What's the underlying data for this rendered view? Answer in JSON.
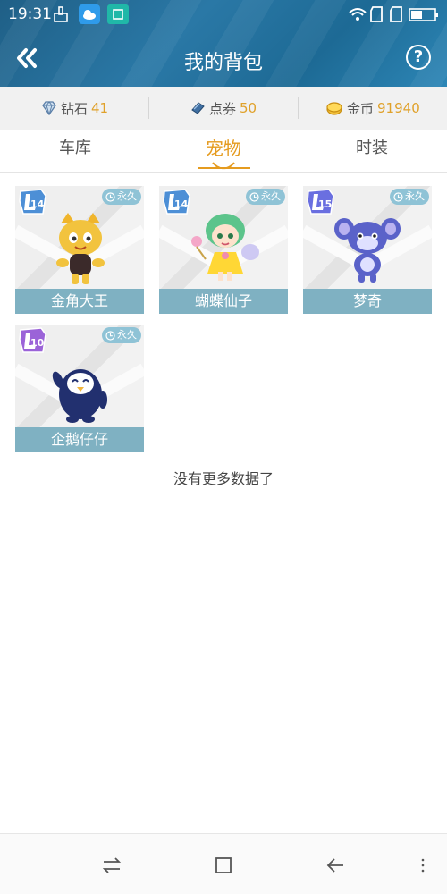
{
  "status_bar": {
    "time": "19:31",
    "icons": [
      "cleaner-icon",
      "weather-icon",
      "screenshot-icon",
      "wifi-icon",
      "sim1-icon",
      "sim2-icon",
      "battery-icon"
    ]
  },
  "header": {
    "title": "我的背包",
    "back_icon": "double-chevron-left-icon",
    "help_label": "?"
  },
  "currency": [
    {
      "name": "钻石",
      "value": "41",
      "icon": "diamond-icon"
    },
    {
      "name": "点券",
      "value": "50",
      "icon": "coupon-icon"
    },
    {
      "name": "金币",
      "value": "91940",
      "icon": "coin-icon"
    }
  ],
  "tabs": [
    {
      "label": "车库",
      "active": false
    },
    {
      "label": "宠物",
      "active": true
    },
    {
      "label": "时装",
      "active": false
    }
  ],
  "items": [
    {
      "name": "金角大王",
      "level": "14",
      "duration": "永久"
    },
    {
      "name": "蝴蝶仙子",
      "level": "14",
      "duration": "永久"
    },
    {
      "name": "梦奇",
      "level": "15",
      "duration": "永久"
    },
    {
      "name": "企鹅仔仔",
      "level": "10",
      "duration": "永久"
    }
  ],
  "footer_text": "没有更多数据了",
  "nav": [
    "menu-switch-icon",
    "home-square-icon",
    "back-arrow-icon",
    "more-icon"
  ],
  "colors": {
    "accent": "#e59b1f",
    "header": "#2a78a6",
    "item_label_bg": "#7fb1c2"
  }
}
